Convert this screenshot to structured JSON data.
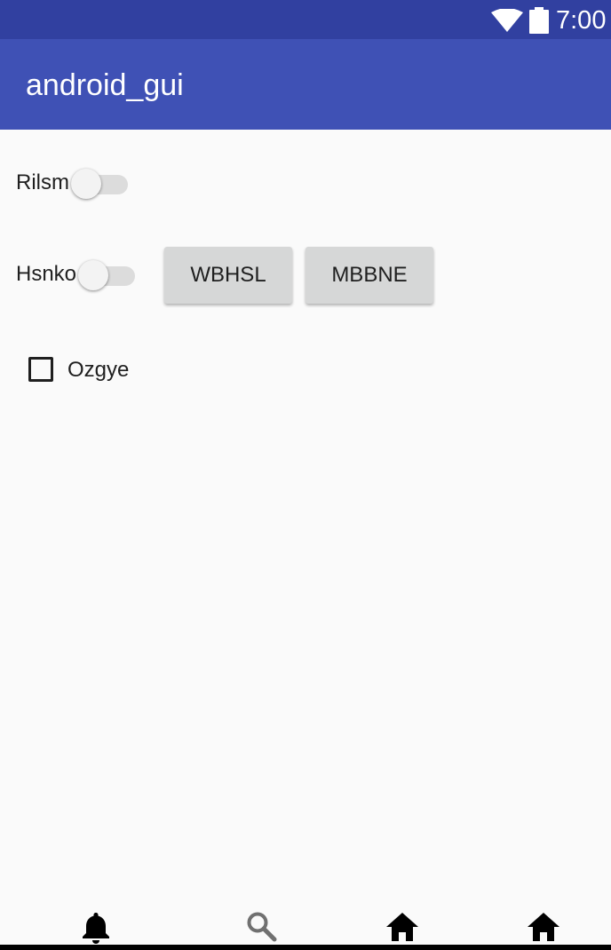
{
  "status_bar": {
    "time": "7:00",
    "icons": [
      "wifi-icon",
      "battery-icon"
    ]
  },
  "app_bar": {
    "title": "android_gui"
  },
  "content": {
    "switch_1": {
      "label": "Rilsm",
      "checked": false
    },
    "switch_2": {
      "label": "Hsnko",
      "checked": false
    },
    "buttons": [
      "WBHSL",
      "MBBNE"
    ],
    "checkbox": {
      "label": "Ozgye",
      "checked": false
    }
  },
  "bottom_nav": {
    "items": [
      {
        "icon": "bell-icon"
      },
      {
        "icon": "search-icon"
      },
      {
        "icon": "home-icon"
      },
      {
        "icon": "home-icon"
      }
    ]
  },
  "colors": {
    "status_bar": "#3140a0",
    "app_bar": "#3f51b5",
    "background": "#fafafa",
    "button": "#d6d7d7"
  }
}
